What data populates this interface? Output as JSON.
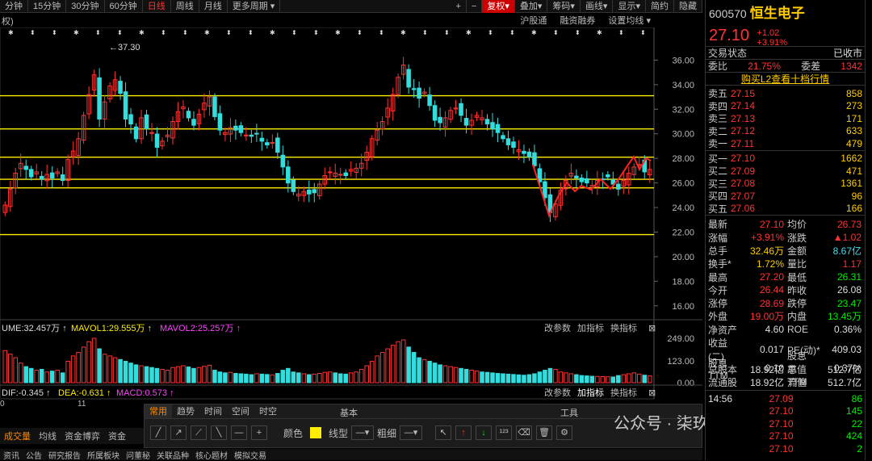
{
  "top_tabs": [
    "分钟",
    "15分钟",
    "30分钟",
    "60分钟",
    "日线",
    "周线",
    "月线",
    "更多周期"
  ],
  "top_right": [
    "+",
    "−",
    "复权",
    "叠加",
    "筹码",
    "画线",
    "显示",
    "简约",
    "隐藏"
  ],
  "sub_left": "权)",
  "sub_links": [
    "沪股通",
    "融资融券",
    "设置均线"
  ],
  "price_axis": [
    "36.00",
    "34.00",
    "32.00",
    "30.00",
    "28.00",
    "26.00",
    "24.00",
    "22.00",
    "20.00",
    "18.00",
    "16.00"
  ],
  "max_label": "37.30",
  "vol_header": {
    "vol": "UME:32.457万",
    "mavol1": "MAVOL1:29.555万",
    "mavol2": "MAVOL2:25.257万"
  },
  "vol_axis": [
    "249.00",
    "123.00",
    "0.00"
  ],
  "panel_links": [
    "改参数",
    "加指标",
    "换指标"
  ],
  "macd_header": {
    "dif": "DIF:-0.345",
    "dea": "DEA:-0.631",
    "macd": "MACD:0.573"
  },
  "date_labels": [
    "0",
    "11"
  ],
  "toolbar_tabs": [
    "常用",
    "趋势",
    "时间",
    "空间",
    "时空"
  ],
  "toolbar_sections": [
    "基本",
    "工具"
  ],
  "toolbar_labels": {
    "color": "颜色",
    "line": "线型",
    "thick": "粗细"
  },
  "bottom_tabs": [
    "成交量",
    "均线",
    "资金博弈",
    "资金"
  ],
  "footer_tabs": [
    "资讯",
    "公告",
    "研究报告",
    "所属板块",
    "问董秘",
    "关联品种",
    "核心题材",
    "模拟交易"
  ],
  "watermark": "公众号 · 柒玖作手",
  "stock": {
    "code": "600570",
    "name": "恒生电子",
    "price": "27.10",
    "change": "+1.02",
    "pct": "+3.91%"
  },
  "status": {
    "label": "交易状态",
    "value": "已收市"
  },
  "ratio": {
    "k1": "委比",
    "v1": "21.75%",
    "k2": "委差",
    "v2": "1342"
  },
  "l2_link": "购买L2查看十档行情",
  "asks": [
    {
      "label": "卖五",
      "price": "27.15",
      "vol": "858"
    },
    {
      "label": "卖四",
      "price": "27.14",
      "vol": "273"
    },
    {
      "label": "卖三",
      "price": "27.13",
      "vol": "171"
    },
    {
      "label": "卖二",
      "price": "27.12",
      "vol": "633"
    },
    {
      "label": "卖一",
      "price": "27.11",
      "vol": "479"
    }
  ],
  "bids": [
    {
      "label": "买一",
      "price": "27.10",
      "vol": "1662"
    },
    {
      "label": "买二",
      "price": "27.09",
      "vol": "471"
    },
    {
      "label": "买三",
      "price": "27.08",
      "vol": "1361"
    },
    {
      "label": "买四",
      "price": "27.07",
      "vol": "96"
    },
    {
      "label": "买五",
      "price": "27.06",
      "vol": "166"
    }
  ],
  "stats": [
    {
      "k1": "最新",
      "v1": "27.10",
      "c1": "red",
      "k2": "均价",
      "v2": "26.73",
      "c2": "red"
    },
    {
      "k1": "涨幅",
      "v1": "+3.91%",
      "c1": "red",
      "k2": "涨跌",
      "v2": "▲1.02",
      "c2": "red"
    },
    {
      "k1": "总手",
      "v1": "32.46万",
      "c1": "yellow",
      "k2": "金额",
      "v2": "8.67亿",
      "c2": "cyan"
    },
    {
      "k1": "换手*",
      "v1": "1.72%",
      "c1": "yellow",
      "k2": "量比",
      "v2": "1.17",
      "c2": "red"
    },
    {
      "k1": "最高",
      "v1": "27.20",
      "c1": "red",
      "k2": "最低",
      "v2": "26.31",
      "c2": "green"
    },
    {
      "k1": "今开",
      "v1": "26.44",
      "c1": "red",
      "k2": "昨收",
      "v2": "26.08",
      "c2": "white"
    },
    {
      "k1": "涨停",
      "v1": "28.69",
      "c1": "red",
      "k2": "跌停",
      "v2": "23.47",
      "c2": "green"
    },
    {
      "k1": "外盘",
      "v1": "19.00万",
      "c1": "red",
      "k2": "内盘",
      "v2": "13.45万",
      "c2": "green"
    },
    {
      "k1": "净资产",
      "v1": "4.60",
      "c1": "white",
      "k2": "ROE",
      "v2": "0.36%",
      "c2": "white"
    },
    {
      "k1": "收益(二)",
      "v1": "0.017",
      "c1": "white",
      "k2": "PE(动)*",
      "v2": "409.03",
      "c2": "white"
    },
    {
      "k1": "股息TTM",
      "v1": "0.10",
      "c1": "white",
      "k2": "股息率TTM",
      "v2": "0.37%",
      "c2": "white"
    },
    {
      "k1": "总股本",
      "v1": "18.92亿",
      "c1": "white",
      "k2": "总值",
      "v2": "512.7亿",
      "c2": "white"
    },
    {
      "k1": "流通股",
      "v1": "18.92亿",
      "c1": "white",
      "k2": "流值",
      "v2": "512.7亿",
      "c2": "white"
    }
  ],
  "ticks": [
    {
      "t": "14:56",
      "p": "27.09",
      "v": "86"
    },
    {
      "t": "",
      "p": "27.10",
      "v": "145"
    },
    {
      "t": "",
      "p": "27.10",
      "v": "22"
    },
    {
      "t": "",
      "p": "27.10",
      "v": "424"
    },
    {
      "t": "",
      "p": "27.10",
      "v": "2"
    }
  ],
  "chart_data": {
    "type": "candlestick",
    "ylim": [
      15,
      38
    ],
    "horizontal_lines": [
      33.1,
      30.4,
      28.1,
      26.3,
      25.6,
      21.8
    ],
    "closes": [
      24.2,
      25.5,
      26.8,
      27.6,
      27.1,
      26.5,
      26.9,
      26.3,
      26.7,
      26.4,
      26.9,
      26.2,
      27.9,
      28.6,
      29.6,
      31.5,
      33.2,
      34.8,
      31.2,
      32.6,
      33.9,
      34.4,
      33.3,
      31.2,
      30.8,
      29.6,
      31.3,
      30.4,
      30.1,
      28.9,
      29.4,
      29.9,
      31.0,
      31.8,
      32.2,
      31.3,
      30.7,
      31.6,
      32.5,
      33.0,
      31.4,
      30.3,
      30.1,
      30.5,
      30.3,
      30.1,
      29.9,
      29.8,
      30.0,
      29.4,
      29.1,
      29.3,
      28.5,
      27.3,
      26.0,
      25.3,
      25.1,
      25.3,
      25.1,
      25.2,
      25.9,
      26.6,
      26.9,
      26.8,
      26.7,
      26.6,
      27.1,
      27.2,
      27.6,
      28.5,
      29.6,
      30.3,
      31.0,
      32.1,
      33.2,
      34.6,
      35.6,
      33.8,
      33.6,
      32.9,
      33.4,
      32.3,
      31.1,
      30.9,
      31.3,
      31.9,
      32.1,
      31.5,
      30.7,
      31.1,
      31.5,
      31.3,
      30.8,
      30.4,
      30.1,
      29.6,
      29.1,
      28.9,
      28.7,
      28.4,
      28.1,
      27.4,
      26.1,
      24.8,
      23.6,
      24.3,
      25.4,
      26.2,
      26.8,
      26.4,
      26.1,
      26.0,
      25.8,
      26.2,
      26.3,
      26.5,
      25.9,
      25.5,
      26.2,
      26.8,
      27.3,
      27.5,
      26.9,
      27.1
    ],
    "volume": [
      180,
      160,
      140,
      110,
      90,
      80,
      70,
      75,
      60,
      65,
      70,
      55,
      120,
      150,
      170,
      200,
      230,
      249,
      190,
      160,
      150,
      140,
      130,
      120,
      110,
      100,
      95,
      90,
      85,
      80,
      75,
      70,
      85,
      90,
      95,
      88,
      80,
      85,
      92,
      98,
      70,
      60,
      55,
      58,
      52,
      50,
      48,
      45,
      50,
      48,
      46,
      44,
      52,
      70,
      80,
      60,
      55,
      50,
      45,
      48,
      52,
      58,
      60,
      55,
      50,
      48,
      55,
      60,
      75,
      95,
      120,
      150,
      170,
      190,
      210,
      230,
      240,
      200,
      170,
      140,
      130,
      120,
      110,
      100,
      95,
      90,
      85,
      80,
      75,
      70,
      65,
      60,
      58,
      55,
      52,
      50,
      48,
      46,
      44,
      42,
      45,
      50,
      60,
      70,
      80,
      75,
      60,
      55,
      50,
      45,
      40,
      38,
      36,
      35,
      34,
      33,
      32,
      40,
      45,
      50,
      55,
      48,
      42,
      38
    ]
  }
}
